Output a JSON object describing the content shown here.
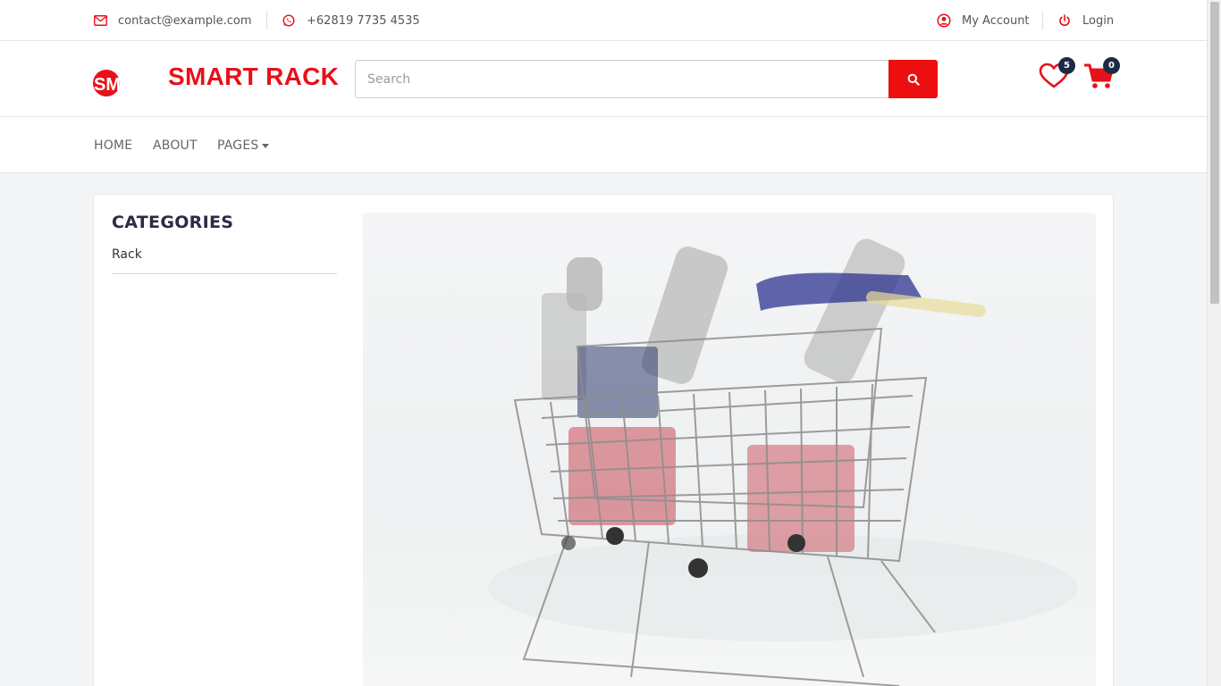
{
  "topbar": {
    "email": "contact@example.com",
    "phone": "+62819 7735 4535",
    "account_label": "My Account",
    "login_label": "Login"
  },
  "header": {
    "logo_text": "SMART",
    "brand_name": "SMART RACK",
    "search_placeholder": "Search",
    "wishlist_count": "5",
    "cart_count": "0"
  },
  "nav": {
    "items": [
      {
        "label": "HOME"
      },
      {
        "label": "ABOUT"
      },
      {
        "label": "PAGES"
      }
    ]
  },
  "categories": {
    "title": "CATEGORIES",
    "items": [
      {
        "label": "Rack"
      }
    ]
  },
  "colors": {
    "accent": "#ec0f0f",
    "badge": "#1d2a44",
    "title": "#2b2b45"
  },
  "icons": {
    "email": "envelope-icon",
    "phone": "whatsapp-icon",
    "account": "user-circle-icon",
    "login": "power-icon",
    "search": "search-icon",
    "wishlist": "heart-icon",
    "cart": "cart-icon"
  }
}
